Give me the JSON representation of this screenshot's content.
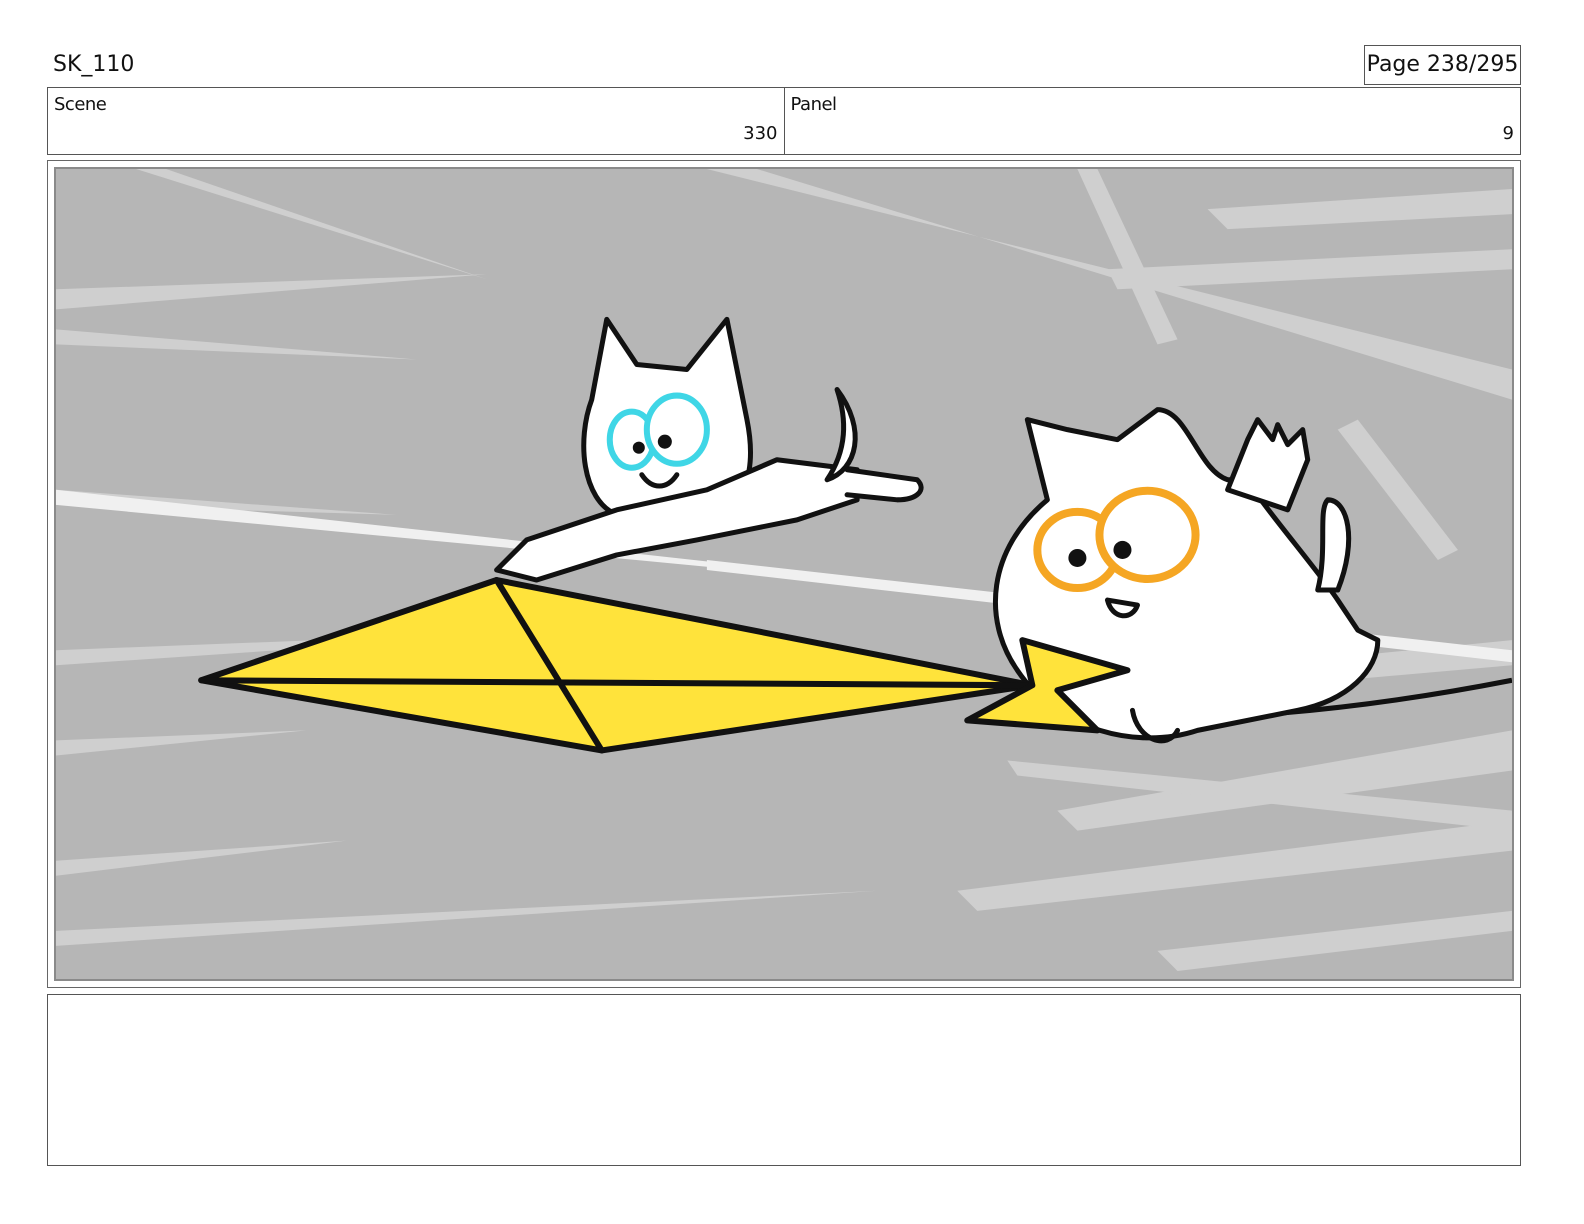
{
  "header": {
    "title": "SK_110",
    "page": "Page 238/295"
  },
  "info": {
    "scene_label": "Scene",
    "scene_value": "330",
    "panel_label": "Panel",
    "panel_value": "9"
  },
  "colors": {
    "background": "#b6b6b6",
    "kite": "#ffe33b",
    "left_cat_eye": "#3fd6e6",
    "right_cat_eye": "#f5a623"
  },
  "notes": {
    "text": ""
  }
}
